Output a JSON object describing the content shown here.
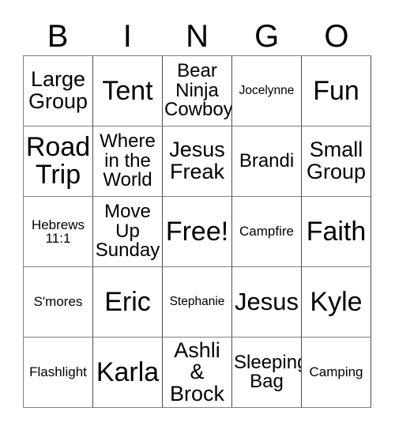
{
  "header": {
    "letters": [
      "B",
      "I",
      "N",
      "G",
      "O"
    ]
  },
  "grid": {
    "free_space_label": "Free!",
    "cells": [
      {
        "text": "Large\nGroup",
        "size": "fs-lg"
      },
      {
        "text": "Tent",
        "size": "fs-xxl"
      },
      {
        "text": "Bear\nNinja\nCowboy",
        "size": "fs-md"
      },
      {
        "text": "Jocelynne",
        "size": "fs-xxs"
      },
      {
        "text": "Fun",
        "size": "fs-xxl"
      },
      {
        "text": "Road\nTrip",
        "size": "fs-xxl"
      },
      {
        "text": "Where\nin the\nWorld",
        "size": "fs-md"
      },
      {
        "text": "Jesus\nFreak",
        "size": "fs-lg"
      },
      {
        "text": "Brandi",
        "size": "fs-md"
      },
      {
        "text": "Small\nGroup",
        "size": "fs-lg"
      },
      {
        "text": "Hebrews\n11:1",
        "size": "fs-xs"
      },
      {
        "text": "Move\nUp\nSunday",
        "size": "fs-md"
      },
      {
        "text": "Free!",
        "size": "fs-xxl"
      },
      {
        "text": "Campfire",
        "size": "fs-xs"
      },
      {
        "text": "Faith",
        "size": "fs-xxl"
      },
      {
        "text": "S'mores",
        "size": "fs-xs"
      },
      {
        "text": "Eric",
        "size": "fs-xxl"
      },
      {
        "text": "Stephanie",
        "size": "fs-xxs"
      },
      {
        "text": "Jesus",
        "size": "fs-xl"
      },
      {
        "text": "Kyle",
        "size": "fs-xxl"
      },
      {
        "text": "Flashlight",
        "size": "fs-xs"
      },
      {
        "text": "Karla",
        "size": "fs-xxl"
      },
      {
        "text": "Ashli &\nBrock",
        "size": "fs-lg"
      },
      {
        "text": "Sleeping\nBag",
        "size": "fs-md"
      },
      {
        "text": "Camping",
        "size": "fs-xs"
      }
    ]
  }
}
